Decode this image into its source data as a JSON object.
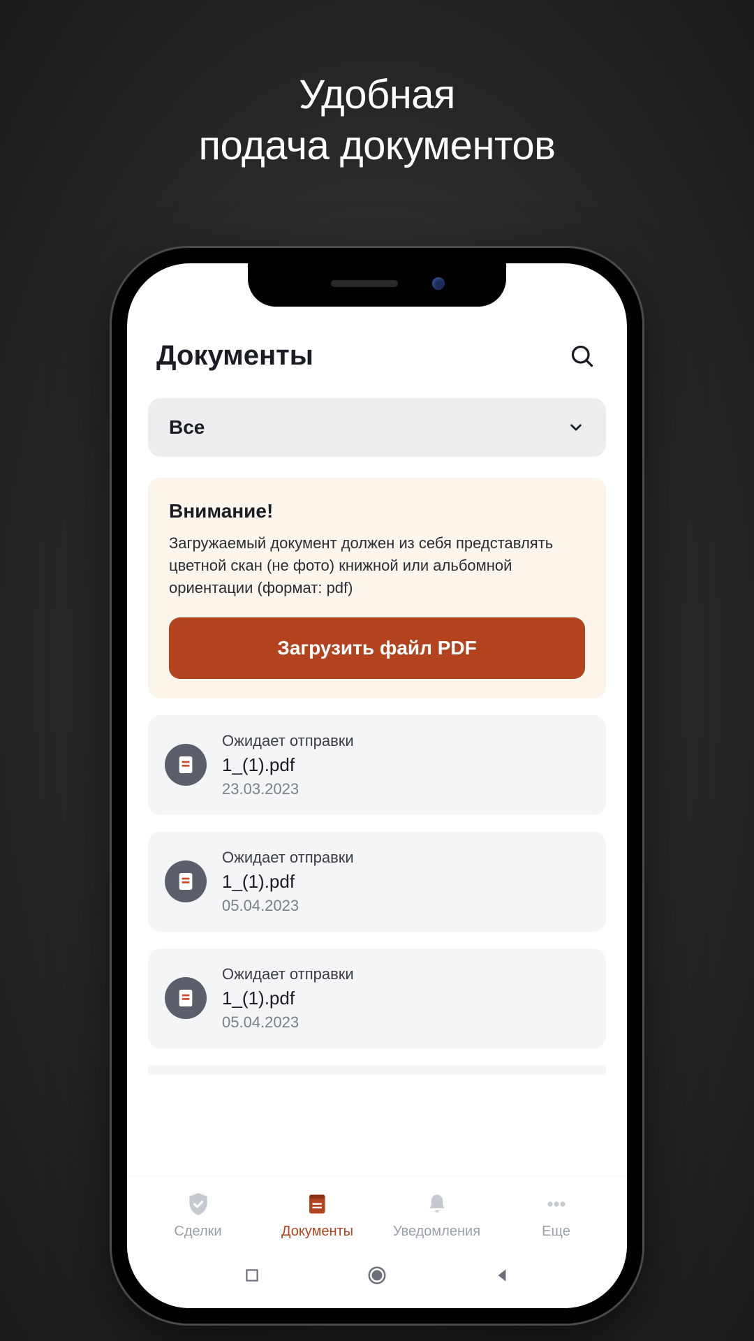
{
  "promo": {
    "line1": "Удобная",
    "line2": "подача документов"
  },
  "header": {
    "title": "Документы"
  },
  "filter": {
    "selected": "Все"
  },
  "notice": {
    "title": "Внимание!",
    "body": "Загружаемый документ должен из себя представлять цветной скан (не фото) книжной или альбомной ориентации (формат: pdf)",
    "upload_label": "Загрузить файл PDF"
  },
  "documents": [
    {
      "status": "Ожидает отправки",
      "name": "1_(1).pdf",
      "date": "23.03.2023"
    },
    {
      "status": "Ожидает отправки",
      "name": "1_(1).pdf",
      "date": "05.04.2023"
    },
    {
      "status": "Ожидает отправки",
      "name": "1_(1).pdf",
      "date": "05.04.2023"
    }
  ],
  "tabs": [
    {
      "label": "Сделки"
    },
    {
      "label": "Документы"
    },
    {
      "label": "Уведомления"
    },
    {
      "label": "Еще"
    }
  ]
}
